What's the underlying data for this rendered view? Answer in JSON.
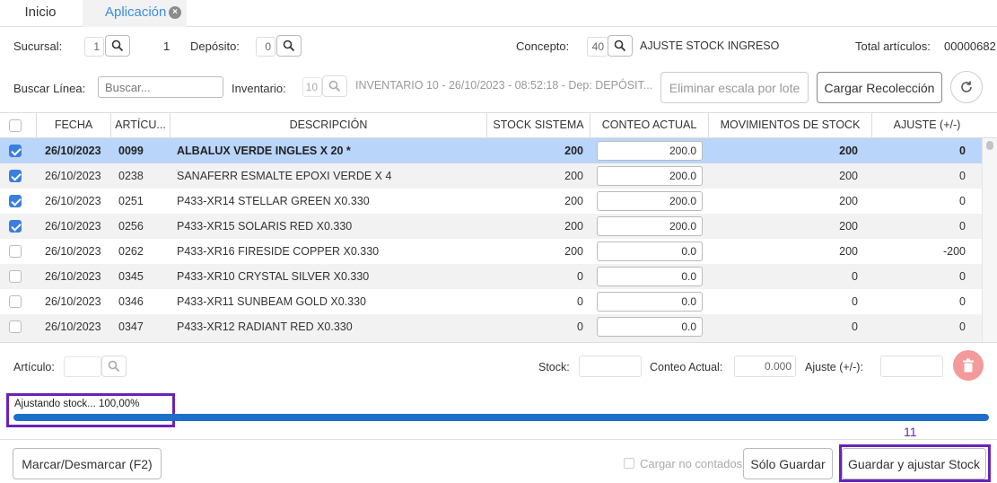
{
  "tabs": {
    "home": "Inicio",
    "app": "Aplicación",
    "close_glyph": "×"
  },
  "header": {
    "sucursal_label": "Sucursal:",
    "sucursal_value": "1",
    "sucursal_name": "1",
    "deposito_label": "Depósito:",
    "deposito_value": "0",
    "concepto_label": "Concepto:",
    "concepto_value": "40",
    "concepto_desc": "AJUSTE STOCK INGRESO",
    "total_label": "Total artículos:",
    "total_value": "00000682",
    "buscar_label": "Buscar Línea:",
    "buscar_placeholder": "Buscar...",
    "inventario_label": "Inventario:",
    "inventario_value": "10",
    "inventario_desc": "INVENTARIO 10 - 26/10/2023 - 08:52:18 - Dep: DEPÓSIT...",
    "eliminar_label": "Eliminar escala por lote",
    "cargar_label": "Cargar Recolección"
  },
  "table": {
    "columns": [
      "FECHA",
      "ARTÍCU...",
      "DESCRIPCIÓN",
      "STOCK SISTEMA",
      "CONTEO ACTUAL",
      "MOVIMIENTOS DE STOCK",
      "AJUSTE (+/-)"
    ],
    "rows": [
      {
        "checked": true,
        "fecha": "26/10/2023",
        "articulo": "0099",
        "descripcion": "ALBALUX VERDE INGLES X 20 *",
        "stock": "200",
        "conteo": "200.0",
        "movimientos": "200",
        "ajuste": "0"
      },
      {
        "checked": true,
        "fecha": "26/10/2023",
        "articulo": "0238",
        "descripcion": "SANAFERR ESMALTE EPOXI VERDE X 4",
        "stock": "200",
        "conteo": "200.0",
        "movimientos": "200",
        "ajuste": "0"
      },
      {
        "checked": true,
        "fecha": "26/10/2023",
        "articulo": "0251",
        "descripcion": "P433-XR14 STELLAR GREEN X0.330",
        "stock": "200",
        "conteo": "200.0",
        "movimientos": "200",
        "ajuste": "0"
      },
      {
        "checked": true,
        "fecha": "26/10/2023",
        "articulo": "0256",
        "descripcion": "P433-XR15 SOLARIS RED X0.330",
        "stock": "200",
        "conteo": "200.0",
        "movimientos": "200",
        "ajuste": "0"
      },
      {
        "checked": false,
        "fecha": "26/10/2023",
        "articulo": "0262",
        "descripcion": "P433-XR16 FIRESIDE COPPER X0.330",
        "stock": "200",
        "conteo": "0.0",
        "movimientos": "200",
        "ajuste": "-200"
      },
      {
        "checked": false,
        "fecha": "26/10/2023",
        "articulo": "0345",
        "descripcion": "P433-XR10 CRYSTAL SILVER X0.330",
        "stock": "0",
        "conteo": "0.0",
        "movimientos": "0",
        "ajuste": "0"
      },
      {
        "checked": false,
        "fecha": "26/10/2023",
        "articulo": "0346",
        "descripcion": "P433-XR11 SUNBEAM GOLD X0.330",
        "stock": "0",
        "conteo": "0.0",
        "movimientos": "0",
        "ajuste": "0"
      },
      {
        "checked": false,
        "fecha": "26/10/2023",
        "articulo": "0347",
        "descripcion": "P433-XR12 RADIANT RED X0.330",
        "stock": "0",
        "conteo": "0.0",
        "movimientos": "0",
        "ajuste": "0"
      }
    ]
  },
  "detail": {
    "articulo_label": "Artículo:",
    "stock_label": "Stock:",
    "conteo_label": "Conteo Actual:",
    "conteo_value": "0.000",
    "ajuste_label": "Ajuste (+/-):"
  },
  "progress": {
    "text": "Ajustando stock... 100,00%",
    "fraction": 1.0
  },
  "footer": {
    "marcar_label": "Marcar/Desmarcar (F2)",
    "cargar_no_contados": "Cargar no contados",
    "solo_guardar": "Sólo Guardar",
    "guardar_ajustar": "Guardar y ajustar Stock",
    "step_number": "11"
  },
  "colors": {
    "accent": "#3a8ee6",
    "selected_row": "#b9d5f9",
    "progress": "#1d6fc9",
    "highlight": "#6a22b8",
    "delete": "#f39a9a"
  },
  "icons": [
    "close-icon",
    "search-icon",
    "refresh-icon",
    "trash-icon",
    "checkbox-icon"
  ]
}
